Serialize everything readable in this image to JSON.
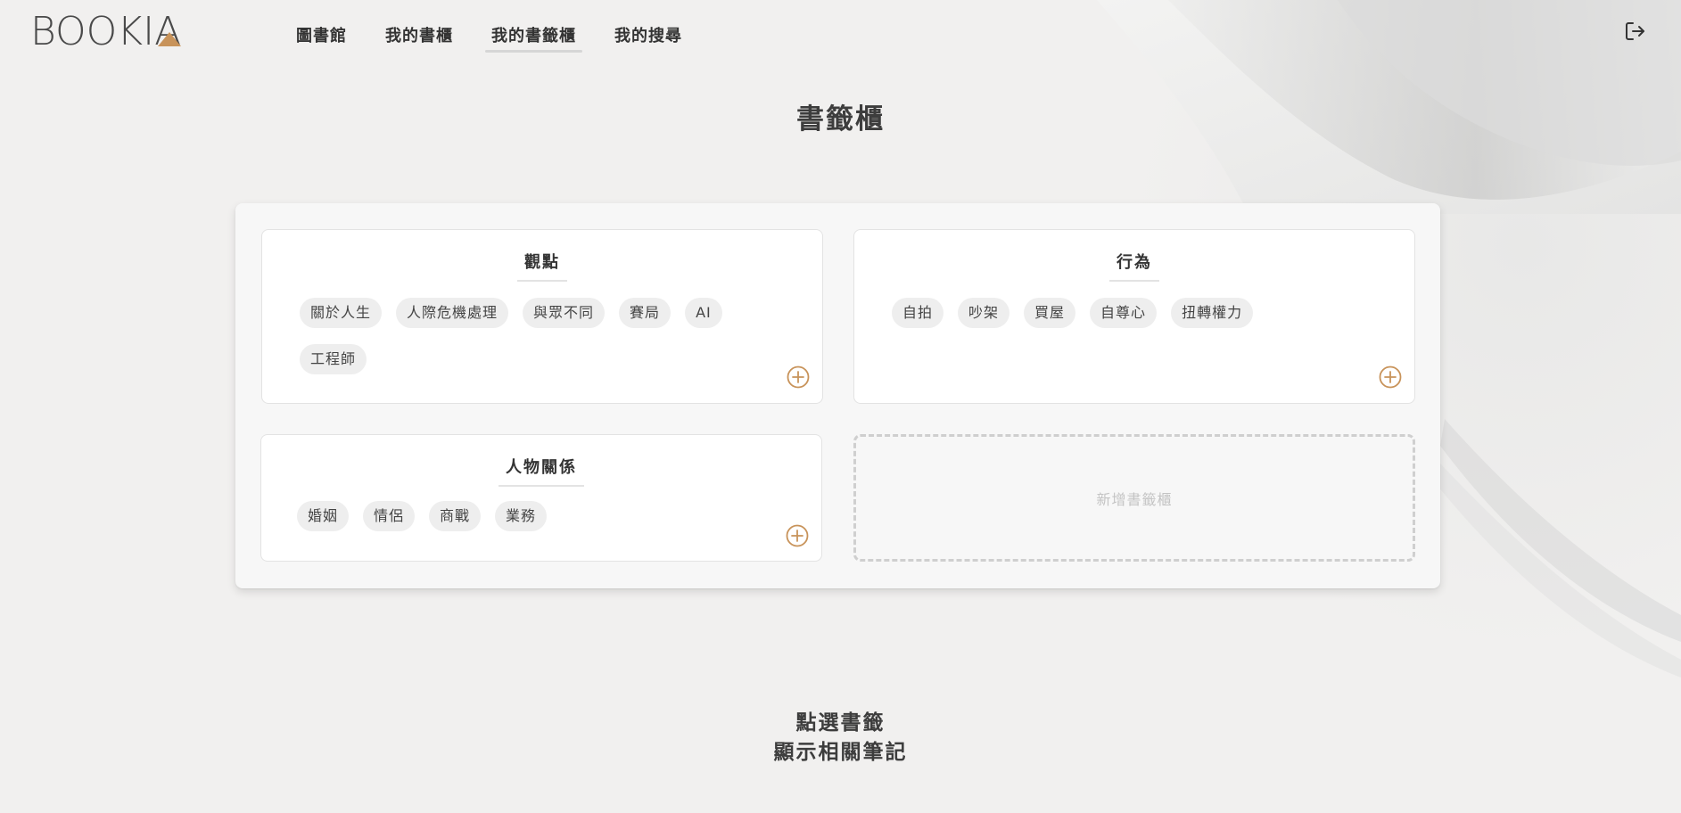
{
  "app": {
    "logo_text": "BOOKIA",
    "accent_color": "#c8935a"
  },
  "nav": {
    "items": [
      {
        "label": "圖書館",
        "active": false
      },
      {
        "label": "我的書櫃",
        "active": false
      },
      {
        "label": "我的書籤櫃",
        "active": true
      },
      {
        "label": "我的搜尋",
        "active": false
      }
    ],
    "logout_icon": "logout-icon"
  },
  "page": {
    "title": "書籤櫃"
  },
  "shelves": [
    {
      "title": "觀點",
      "tags": [
        "關於人生",
        "人際危機處理",
        "與眾不同",
        "賽局",
        "AI",
        "工程師"
      ]
    },
    {
      "title": "行為",
      "tags": [
        "自拍",
        "吵架",
        "買屋",
        "自尊心",
        "扭轉權力"
      ]
    },
    {
      "title": "人物關係",
      "tags": [
        "婚姻",
        "情侶",
        "商戰",
        "業務"
      ]
    }
  ],
  "new_shelf_label": "新增書籤櫃",
  "hint": {
    "line1": "點選書籤",
    "line2": "顯示相關筆記"
  }
}
